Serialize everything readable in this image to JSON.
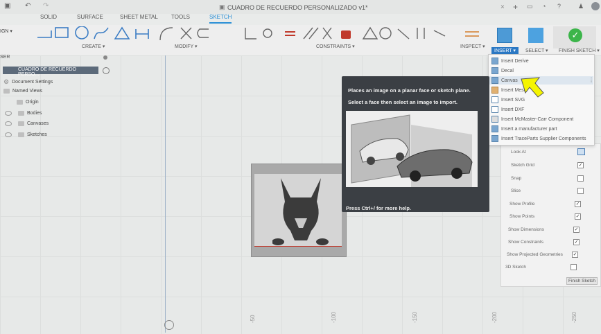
{
  "window": {
    "title": "CUADRO DE RECUERDO PERSONALIZADO v1*"
  },
  "tabs": [
    {
      "label": "SOLID"
    },
    {
      "label": "SURFACE"
    },
    {
      "label": "SHEET METAL"
    },
    {
      "label": "TOOLS"
    },
    {
      "label": "SKETCH"
    }
  ],
  "toolbar": {
    "workspace_label": "IGN ▾",
    "groups": {
      "create": "CREATE ▾",
      "modify": "MODIFY ▾",
      "constraints": "CONSTRAINTS ▾",
      "inspect": "INSPECT ▾",
      "insert": "INSERT ▾",
      "select": "SELECT ▾",
      "finish": "FINISH SKETCH ▾"
    }
  },
  "browser": {
    "header": "SER",
    "root": "CUADRO DE RECUERDO PERSO...",
    "items": [
      {
        "label": "Document Settings"
      },
      {
        "label": "Named Views"
      },
      {
        "label": "Origin"
      },
      {
        "label": "Bodies"
      },
      {
        "label": "Canvases"
      },
      {
        "label": "Sketches"
      }
    ]
  },
  "insert_menu": {
    "items": [
      {
        "label": "Insert Derive"
      },
      {
        "label": "Decal"
      },
      {
        "label": "Canvas"
      },
      {
        "label": "Insert Mesh"
      },
      {
        "label": "Insert SVG"
      },
      {
        "label": "Insert DXF"
      },
      {
        "label": "Insert McMaster-Carr Component"
      },
      {
        "label": "Insert a manufacturer part"
      },
      {
        "label": "Insert TraceParts Supplier Components"
      }
    ]
  },
  "tooltip": {
    "line1": "Places an image on a planar face or sketch plane.",
    "line2": "Select a face then select an image to import.",
    "footer": "Press Ctrl+/ for more help."
  },
  "sketch_palette": {
    "rows": [
      {
        "label": "Look At",
        "checked": null
      },
      {
        "label": "Sketch Grid",
        "checked": true
      },
      {
        "label": "Snap",
        "checked": false
      },
      {
        "label": "Slice",
        "checked": false
      },
      {
        "label": "Show Profile",
        "checked": true
      },
      {
        "label": "Show Points",
        "checked": true
      },
      {
        "label": "Show Dimensions",
        "checked": true
      },
      {
        "label": "Show Constraints",
        "checked": true
      },
      {
        "label": "Show Projected Geometries",
        "checked": true
      },
      {
        "label": "3D Sketch",
        "checked": false
      }
    ],
    "finish_label": "Finish Sketch"
  },
  "axis_labels": [
    "-50",
    "-100",
    "-150",
    "-200",
    "-250"
  ],
  "colors": {
    "accent": "#2b8fd6",
    "finish": "#3cb54a",
    "tooltip_bg": "#3b3f44",
    "cursor": "#f5f500"
  }
}
